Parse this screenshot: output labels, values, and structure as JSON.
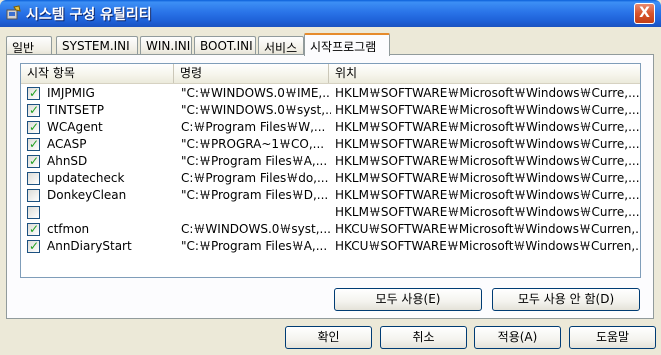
{
  "window": {
    "title": "시스템 구성 유틸리티",
    "close_label": "X"
  },
  "tabs": [
    {
      "label": "일반"
    },
    {
      "label": "SYSTEM.INI"
    },
    {
      "label": "WIN.INI"
    },
    {
      "label": "BOOT.INI"
    },
    {
      "label": "서비스"
    },
    {
      "label": "시작프로그램"
    }
  ],
  "active_tab": "시작프로그램",
  "startup_list": {
    "columns": [
      "시작 항목",
      "명령",
      "위치"
    ],
    "rows": [
      {
        "checked": true,
        "item": "IMJPMIG",
        "command": "\"C:￦WINDOWS.0￦IME,...",
        "location": "HKLM￦SOFTWARE￦Microsoft￦Windows￦Curre,..."
      },
      {
        "checked": true,
        "item": "TINTSETP",
        "command": "\"C:￦WINDOWS.0￦syst,...",
        "location": "HKLM￦SOFTWARE￦Microsoft￦Windows￦Curre,..."
      },
      {
        "checked": true,
        "item": "WCAgent",
        "command": "C:￦Program Files￦W,...",
        "location": "HKLM￦SOFTWARE￦Microsoft￦Windows￦Curre,..."
      },
      {
        "checked": true,
        "item": "ACASP",
        "command": "\"C:￦PROGRA~1￦CO,...",
        "location": "HKLM￦SOFTWARE￦Microsoft￦Windows￦Curre,..."
      },
      {
        "checked": true,
        "item": "AhnSD",
        "command": "\"C:￦Program Files￦A,...",
        "location": "HKLM￦SOFTWARE￦Microsoft￦Windows￦Curre,..."
      },
      {
        "checked": false,
        "item": "updatecheck",
        "command": "C:￦Program Files￦do,...",
        "location": "HKLM￦SOFTWARE￦Microsoft￦Windows￦Curre,..."
      },
      {
        "checked": false,
        "item": "DonkeyClean",
        "command": "\"C:￦Program Files￦D,...",
        "location": "HKLM￦SOFTWARE￦Microsoft￦Windows￦Curre,..."
      },
      {
        "checked": false,
        "item": "",
        "command": "",
        "location": "HKLM￦SOFTWARE￦Microsoft￦Windows￦Curre,..."
      },
      {
        "checked": true,
        "item": "ctfmon",
        "command": "C:￦WINDOWS.0￦syst,...",
        "location": "HKCU￦SOFTWARE￦Microsoft￦Windows￦Curren,..."
      },
      {
        "checked": true,
        "item": "AnnDiaryStart",
        "command": "\"C:￦Program Files￦A,...",
        "location": "HKCU￦SOFTWARE￦Microsoft￦Windows￦Curren,..."
      }
    ]
  },
  "buttons": {
    "enable_all": "모두 사용(E)",
    "disable_all": "모두 사용 안 함(D)",
    "ok": "확인",
    "cancel": "취소",
    "apply": "적용(A)",
    "help": "도움말"
  },
  "colors": {
    "titlebar": "#2a74e8",
    "face": "#ece9d8",
    "check": "#21a121",
    "active_tab_accent": "#e68b2c"
  }
}
